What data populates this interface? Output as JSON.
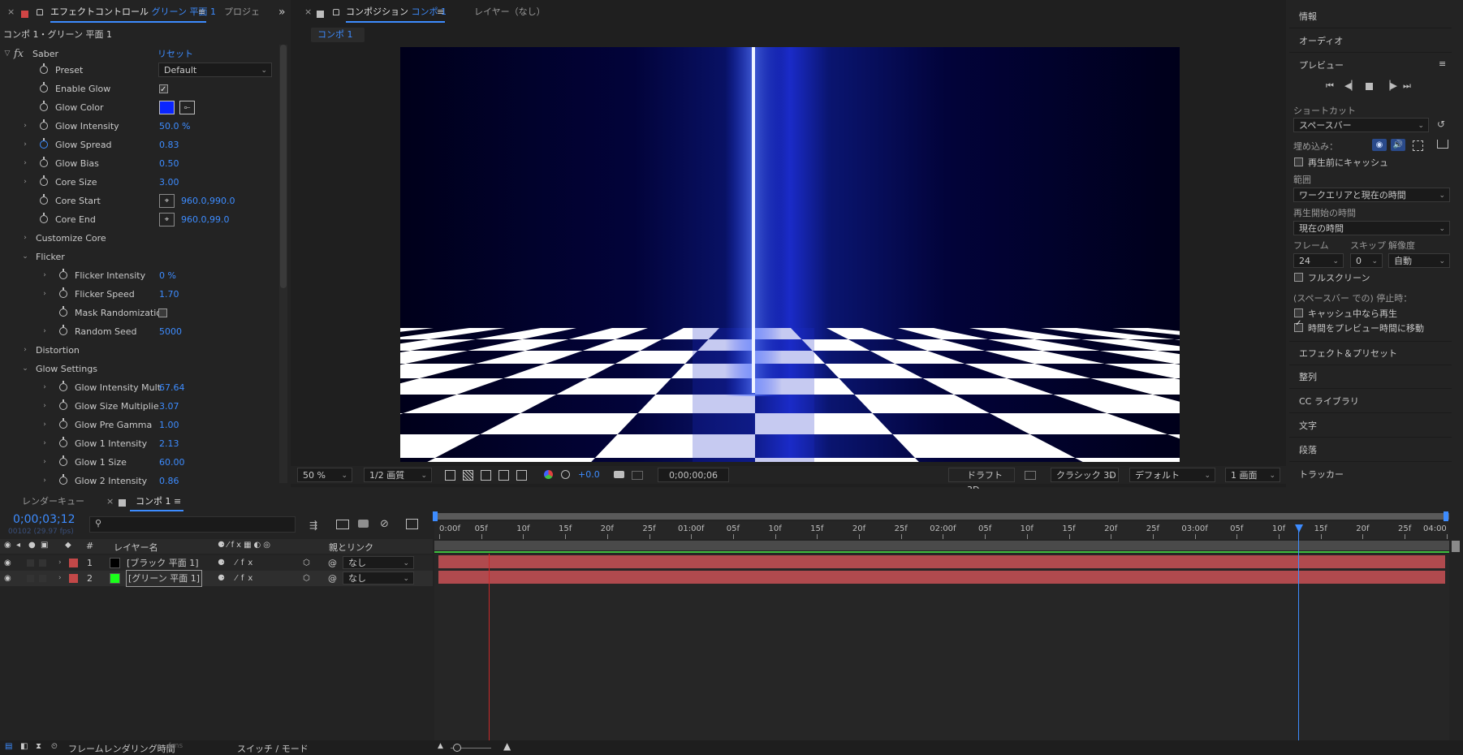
{
  "left_panel": {
    "tab_close": "×",
    "tab_title_prefix": "エフェクトコントロール",
    "tab_title_layer": "グリーン 平面 1",
    "tab_menu": "≡",
    "tab_project": "プロジェ",
    "more": "»",
    "breadcrumb": "コンポ 1・グリーン 平面 1",
    "effect_name": "Saber",
    "reset_label": "リセット",
    "rows": [
      {
        "label": "Preset",
        "value": "Default"
      },
      {
        "label": "Enable Glow",
        "value": ""
      },
      {
        "label": "Glow Color",
        "value": ""
      },
      {
        "label": "Glow Intensity",
        "value": "50.0 %"
      },
      {
        "label": "Glow Spread",
        "value": "0.83"
      },
      {
        "label": "Glow Bias",
        "value": "0.50"
      },
      {
        "label": "Core Size",
        "value": "3.00"
      },
      {
        "label": "Core Start",
        "value": "960.0,990.0"
      },
      {
        "label": "Core End",
        "value": "960.0,99.0"
      },
      {
        "label": "Customize Core",
        "value": ""
      },
      {
        "label": "Flicker",
        "value": ""
      },
      {
        "label": "Flicker Intensity",
        "value": "0 %"
      },
      {
        "label": "Flicker Speed",
        "value": "1.70"
      },
      {
        "label": "Mask Randomizatio",
        "value": ""
      },
      {
        "label": "Random Seed",
        "value": "5000"
      },
      {
        "label": "Distortion",
        "value": ""
      },
      {
        "label": "Glow Settings",
        "value": ""
      },
      {
        "label": "Glow Intensity Mult",
        "value": "67.64"
      },
      {
        "label": "Glow Size Multiplie",
        "value": "3.07"
      },
      {
        "label": "Glow Pre Gamma",
        "value": "1.00"
      },
      {
        "label": "Glow 1 Intensity",
        "value": "2.13"
      },
      {
        "label": "Glow 1 Size",
        "value": "60.00"
      },
      {
        "label": "Glow 2 Intensity",
        "value": "0.86"
      }
    ],
    "glow_color_hex": "#0a25ff"
  },
  "comp_panel": {
    "tab_close": "×",
    "tab_title_prefix": "コンポジション",
    "tab_title_comp": "コンポ 1",
    "tab_menu": "≡",
    "layer_tab": "レイヤー（なし）",
    "sub_tab": "コンポ 1",
    "zoom": "50 %",
    "quality": "1/2 画質",
    "exposure": "+0.0",
    "timecode": "0;00;00;06",
    "draft3d": "ドラフト 3D",
    "renderer": "クラシック 3D",
    "view": "デフォルト",
    "views_count": "1 画面"
  },
  "right_panel": {
    "info": "情報",
    "audio": "オーディオ",
    "preview": "プレビュー",
    "preview_menu": "≡",
    "shortcut_label": "ショートカット",
    "shortcut_value": "スペースバー",
    "embed_label": "埋め込み：",
    "cache_before": "再生前にキャッシュ",
    "range_label": "範囲",
    "range_value": "ワークエリアと現在の時間",
    "start_label": "再生開始の時間",
    "start_value": "現在の時間",
    "frame_label": "フレーム",
    "skip_label": "スキップ",
    "resolution_label": "解像度",
    "frame_value": "24",
    "skip_value": "0",
    "resolution_value": "自動",
    "fullscreen": "フルスクリーン",
    "stop_label": "(スペースバー での) 停止時：",
    "play_if_caching": "キャッシュ中なら再生",
    "move_time": "時間をプレビュー時間に移動",
    "effects_presets": "エフェクト＆プリセット",
    "align": "整列",
    "cc_libraries": "CC ライブラリ",
    "character": "文字",
    "paragraph": "段落",
    "tracker": "トラッカー"
  },
  "timeline": {
    "render_queue_tab": "レンダーキュー",
    "comp_tab": "コンポ 1",
    "tab_menu": "≡",
    "tab_close": "×",
    "current_time": "0;00;03;12",
    "current_frames": "00102 (29.97 fps)",
    "search_placeholder": "",
    "col_layer_name": "レイヤー名",
    "col_num": "#",
    "col_parent": "親とリンク",
    "layers": [
      {
        "num": "1",
        "name": "[ブラック 平面 1]",
        "swatch": "#000000",
        "parent": "なし"
      },
      {
        "num": "2",
        "name": "[グリーン 平面 1]",
        "swatch": "#1aff1a",
        "parent": "なし"
      }
    ],
    "ruler": [
      "0:00f",
      "05f",
      "10f",
      "15f",
      "20f",
      "25f",
      "01:00f",
      "05f",
      "10f",
      "15f",
      "20f",
      "25f",
      "02:00f",
      "05f",
      "10f",
      "15f",
      "20f",
      "25f",
      "03:00f",
      "05f",
      "10f",
      "15f",
      "20f",
      "25f",
      "04:00"
    ],
    "bottom_render_time_label": "フレームレンダリング時間",
    "bottom_render_time_value": "4ms",
    "bottom_switch_mode": "スイッチ / モード"
  }
}
